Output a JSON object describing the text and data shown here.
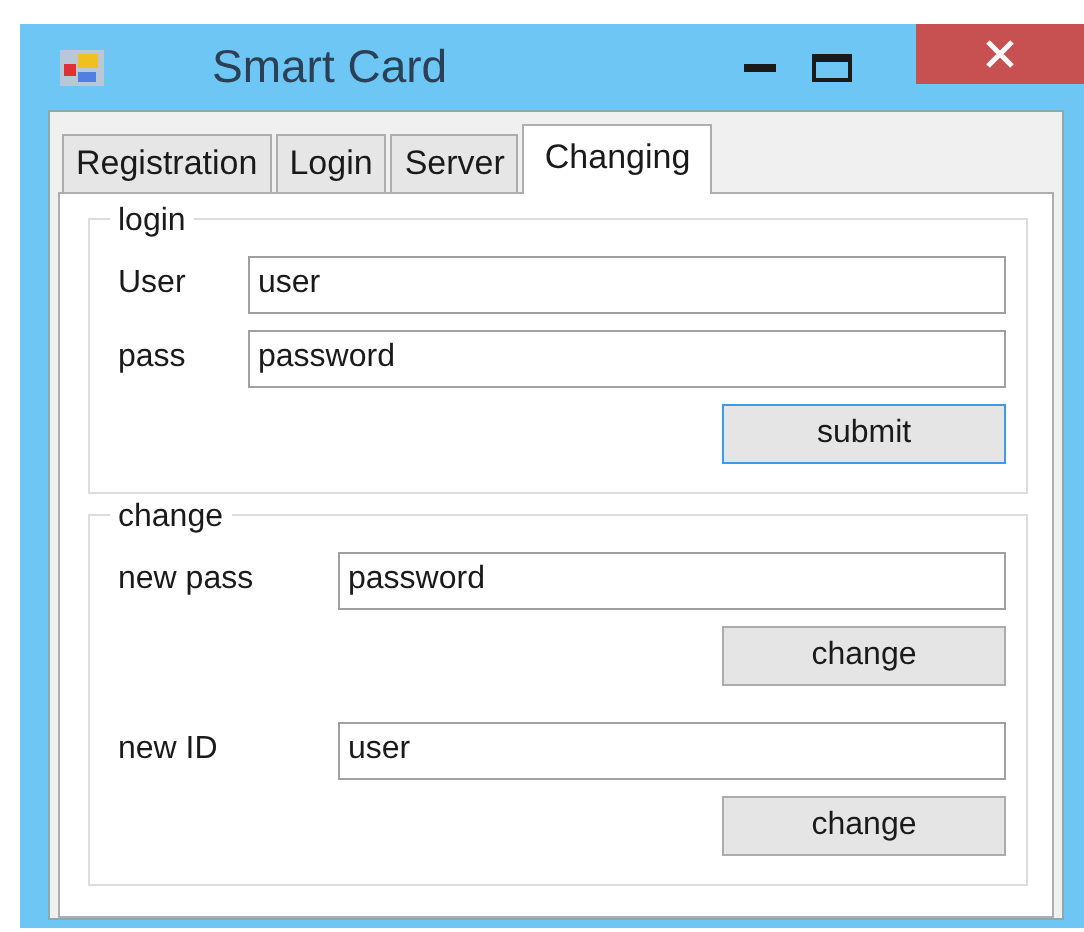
{
  "window": {
    "title": "Smart Card"
  },
  "tabs": [
    {
      "label": "Registration",
      "selected": false
    },
    {
      "label": "Login",
      "selected": false
    },
    {
      "label": "Server",
      "selected": false
    },
    {
      "label": "Changing",
      "selected": true
    }
  ],
  "groups": [
    {
      "title": "login",
      "rows": [
        {
          "kind": "field",
          "label": "User",
          "value": "user"
        },
        {
          "kind": "field",
          "label": "pass",
          "value": "password"
        },
        {
          "kind": "button",
          "label": "submit",
          "focused": true
        }
      ]
    },
    {
      "title": "change",
      "rows": [
        {
          "kind": "field",
          "label": "new pass",
          "value": "password"
        },
        {
          "kind": "button",
          "label": "change",
          "focused": false
        },
        {
          "kind": "field",
          "label": "new ID",
          "value": "user"
        },
        {
          "kind": "button",
          "label": "change",
          "focused": false
        }
      ]
    }
  ]
}
